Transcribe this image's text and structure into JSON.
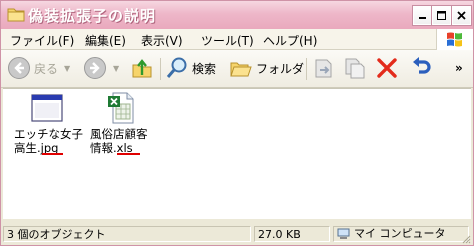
{
  "window": {
    "title": "偽装拡張子の説明"
  },
  "menu": [
    {
      "label": "ファイル(F)"
    },
    {
      "label": "編集(E)"
    },
    {
      "label": "表示(V)"
    },
    {
      "label": "ツール(T)"
    },
    {
      "label": "ヘルプ(H)"
    }
  ],
  "toolbar": {
    "back_label": "戻る",
    "search_label": "検索",
    "folders_label": "フォルダ"
  },
  "files": [
    {
      "name_line1": "エッチな女子",
      "name_line2": "高生.jpg",
      "icon": "window-app-icon"
    },
    {
      "name_line1": "風俗店顧客",
      "name_line2": "情報.xls",
      "icon": "excel-file-icon"
    }
  ],
  "status": {
    "objects": "3 個のオブジェクト",
    "size": "27.0 KB",
    "location": "マイ コンピュータ"
  },
  "colors": {
    "titlebar": "#eeb7c9",
    "underline": "#e00000"
  }
}
